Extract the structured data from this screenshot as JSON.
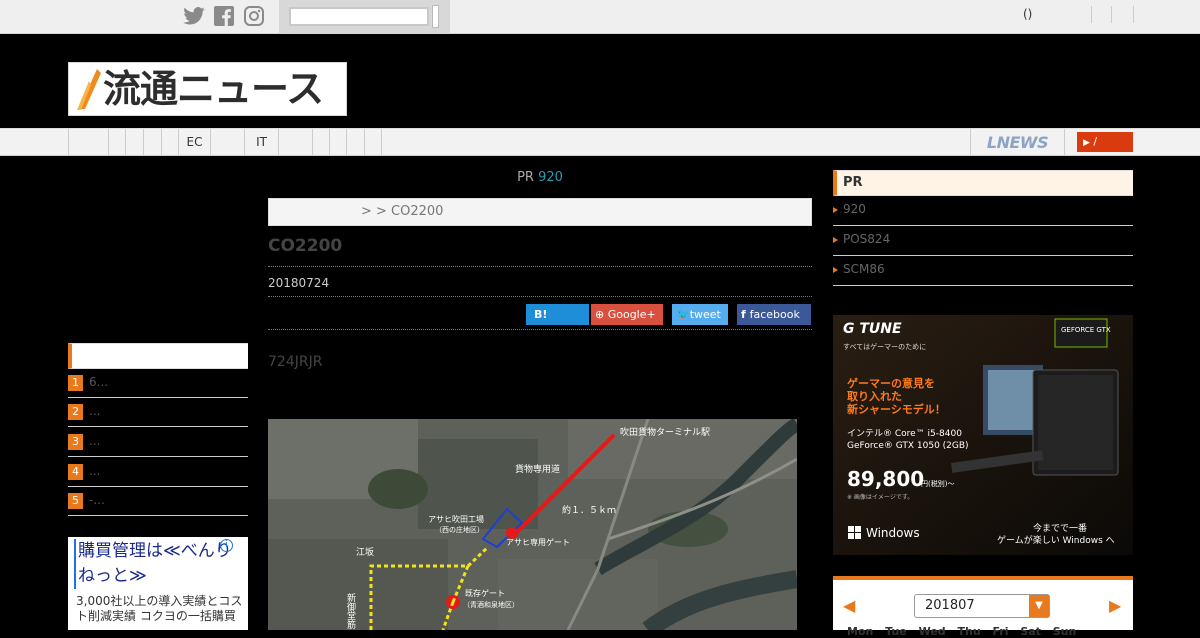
{
  "topbar": {
    "search_placeholder": "",
    "user_links": "()"
  },
  "header": {
    "logo_text": "流通ニュース"
  },
  "nav": {
    "items": [
      "",
      "",
      "",
      "",
      "",
      "EC",
      "",
      "IT",
      "",
      "",
      "",
      "",
      ""
    ],
    "lnews_label": "LNEWS",
    "rss_label": "/"
  },
  "article": {
    "pr_prefix": "PR",
    "pr_count": "920",
    "breadcrumb": ">     >   CO2200",
    "title": "CO2200",
    "date": "20180724",
    "share": {
      "hatena": "B!",
      "google": "Google+",
      "twitter": "tweet",
      "facebook": "facebook"
    },
    "lead": "724JRJR"
  },
  "map_labels": {
    "terminal": "吹田貨物ターミナル駅",
    "private_line": "貨物専用道",
    "distance": "約１．５ｋｍ",
    "factory": "アサヒ吹田工場",
    "factory_sub": "（西の庄地区）",
    "gate_new": "アサヒ専用ゲート",
    "jr": "江坂",
    "gate_old": "既存ゲート",
    "gate_old_sub": "（青酒和泉地区）",
    "vertical": "新御堂筋"
  },
  "left_sidebar": {
    "ranking": [
      {
        "rank": "1",
        "title": "6..."
      },
      {
        "rank": "2",
        "title": "..."
      },
      {
        "rank": "3",
        "title": "..."
      },
      {
        "rank": "4",
        "title": "..."
      },
      {
        "rank": "5",
        "title": "-..."
      }
    ],
    "ad": {
      "title": "購買管理は≪べんりねっと≫",
      "desc": "3,000社以上の導入実績とコスト削減実績 コクヨの一括購買"
    }
  },
  "right_sidebar": {
    "pr_heading": "PR",
    "pr_items": [
      "920",
      "POS824",
      "SCM86"
    ],
    "banner": {
      "brand": "G TUNE",
      "tagline": "すべてはゲーマーのために",
      "gpu_badge": "GEFORCE GTX",
      "headline1": "ゲーマーの意見を",
      "headline2": "取り入れた",
      "headline3": "新シャーシモデル！",
      "cpu": "インテル® Core™ i5-8400",
      "gpu": "GeForce® GTX 1050 (2GB)",
      "price": "89,800",
      "price_unit": "円(税別)～",
      "note": "※ 画像はイメージです。",
      "os": "Windows",
      "cta1": "今までで一番",
      "cta2": "ゲームが楽しい Windows へ"
    },
    "calendar": {
      "month": "201807",
      "days": "Mon Tue Wed Thu Fri Sat Sun"
    }
  },
  "colors": {
    "accent": "#e87a1d",
    "link": "#2a9bb0"
  }
}
